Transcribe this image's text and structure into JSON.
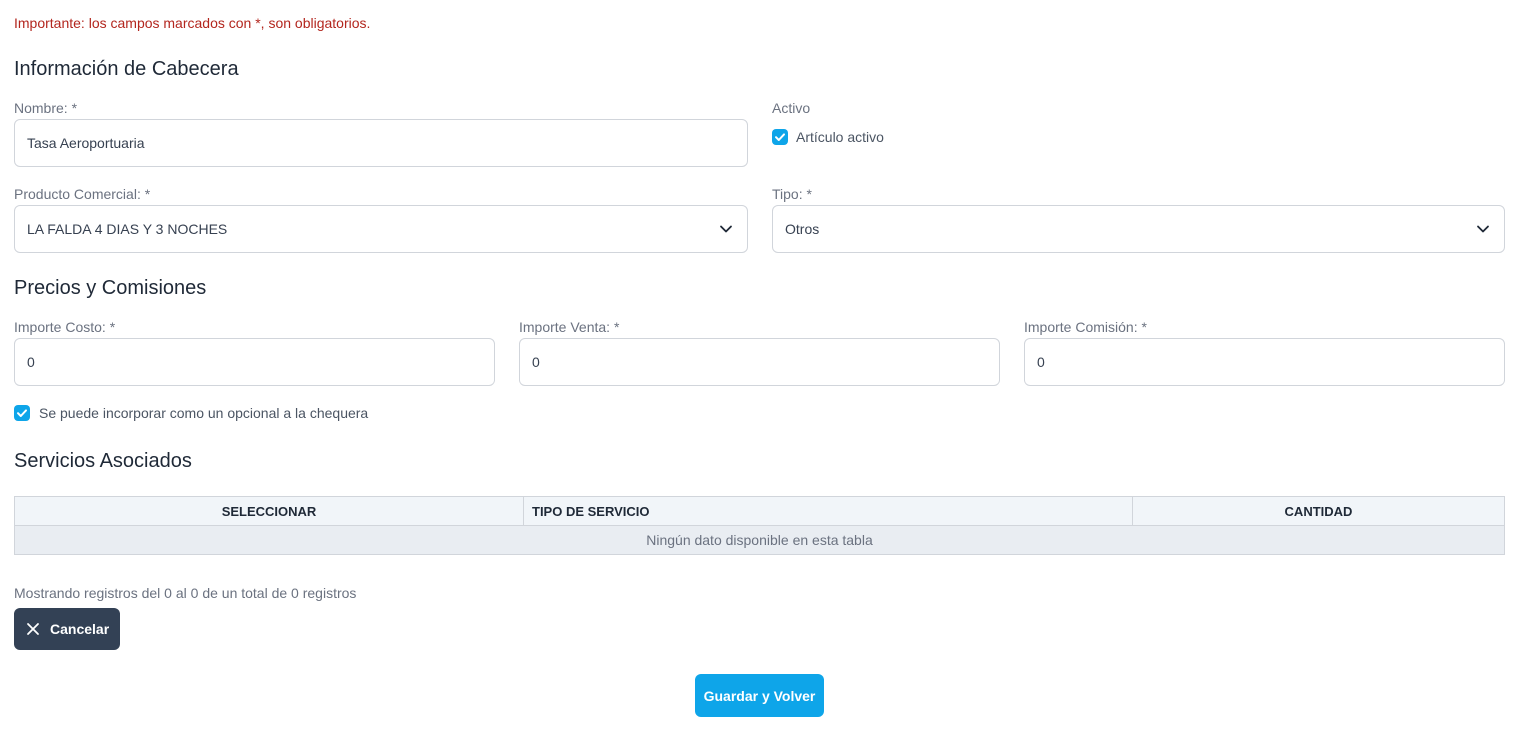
{
  "notice": "Importante: los campos marcados con *, son obligatorios.",
  "header_section": {
    "title": "Información de Cabecera",
    "nombre": {
      "label": "Nombre: *",
      "value": "Tasa Aeroportuaria"
    },
    "activo": {
      "label": "Activo",
      "checkbox_label": "Artículo activo",
      "checked": true
    },
    "producto": {
      "label": "Producto Comercial: *",
      "value": "LA FALDA 4 DIAS Y 3 NOCHES"
    },
    "tipo": {
      "label": "Tipo: *",
      "value": "Otros"
    }
  },
  "prices_section": {
    "title": "Precios y Comisiones",
    "costo": {
      "label": "Importe Costo: *",
      "value": "0"
    },
    "venta": {
      "label": "Importe Venta: *",
      "value": "0"
    },
    "comision": {
      "label": "Importe Comisión: *",
      "value": "0"
    },
    "optional": {
      "label": "Se puede incorporar como un opcional a la chequera",
      "checked": true
    }
  },
  "services_section": {
    "title": "Servicios Asociados",
    "columns": [
      "SELECCIONAR",
      "TIPO DE SERVICIO",
      "CANTIDAD"
    ],
    "empty_message": "Ningún dato disponible en esta tabla",
    "footer_info": "Mostrando registros del 0 al 0 de un total de 0 registros"
  },
  "buttons": {
    "cancel": "Cancelar",
    "save": "Guardar y Volver"
  },
  "colors": {
    "accent": "#0ea5e9",
    "dark": "#334155",
    "notice": "#b3261e"
  },
  "icons": {
    "checkbox": "check-icon",
    "select": "chevron-down-icon",
    "cancel": "close-icon"
  }
}
